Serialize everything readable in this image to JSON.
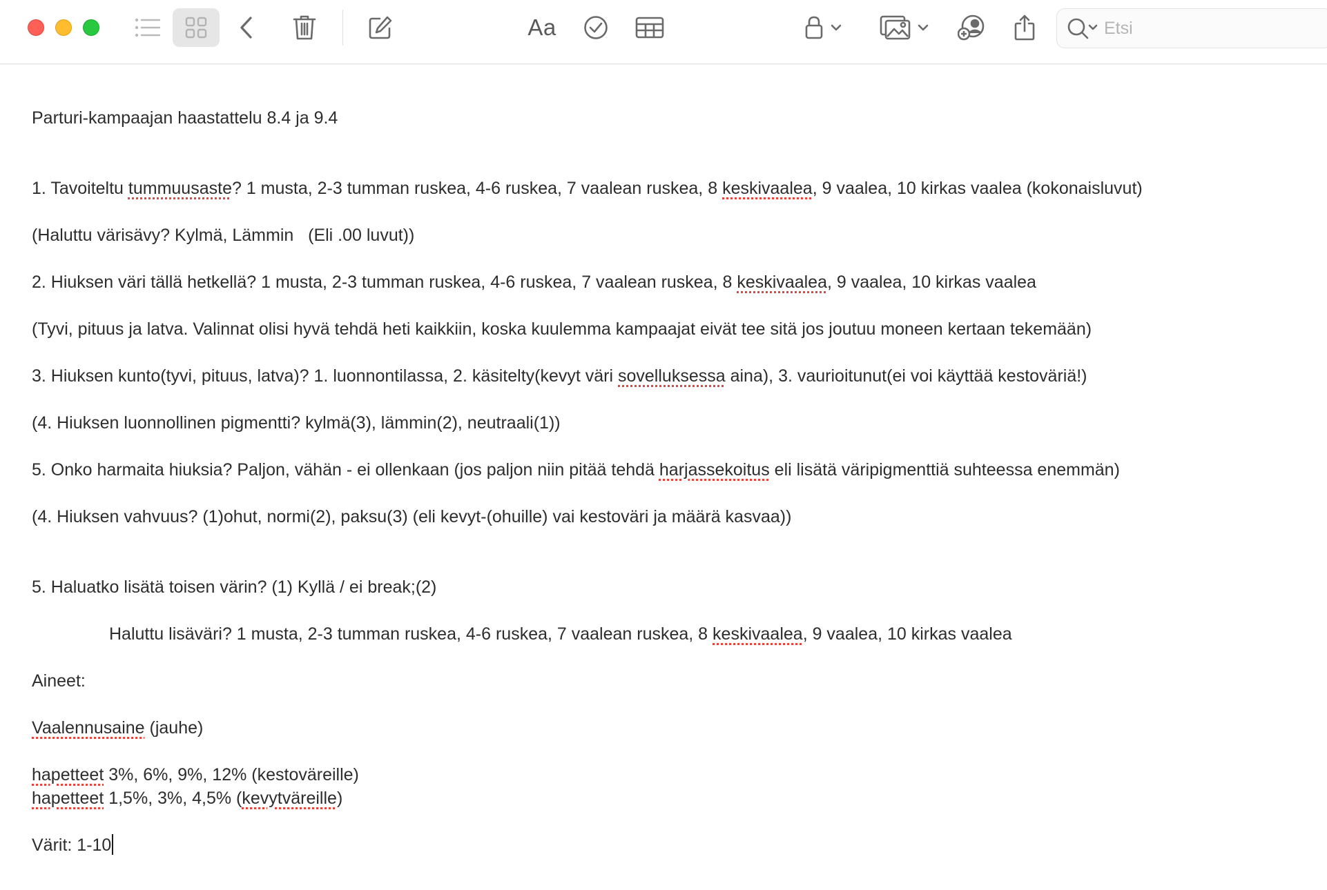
{
  "toolbar": {
    "search_placeholder": "Etsi",
    "format_label": "Aa"
  },
  "note": {
    "title": "Parturi-kampaajan haastattelu 8.4 ja 9.4",
    "q1": {
      "pre": "1. Tavoiteltu ",
      "sp1": "tummuusaste",
      "mid": "? 1 musta, 2-3 tumman ruskea, 4-6 ruskea, 7 vaalean ruskea, 8 ",
      "sp2": "keskivaalea",
      "post": ", 9 vaalea, 10 kirkas vaalea (kokonaisluvut)"
    },
    "q1_note": "(Haluttu värisävy? Kylmä, Lämmin   (Eli .00 luvut))",
    "q2": {
      "pre": "2. Hiuksen väri tällä hetkellä? 1 musta, 2-3 tumman ruskea, 4-6 ruskea, 7 vaalean ruskea, 8 ",
      "sp": "keskivaalea",
      "post": ", 9 vaalea, 10 kirkas vaalea"
    },
    "q2_note": "(Tyvi, pituus ja latva. Valinnat olisi hyvä tehdä heti kaikkiin, koska kuulemma kampaajat eivät tee sitä jos joutuu moneen kertaan tekemään)",
    "q3": {
      "pre": "3. Hiuksen kunto(tyvi, pituus, latva)? 1. luonnontilassa, 2. käsitelty(kevyt väri ",
      "sp": "sovelluksessa",
      "post": " aina), 3. vaurioitunut(ei voi käyttää kestoväriä!)"
    },
    "q4a": "(4. Hiuksen luonnollinen pigmentti? kylmä(3), lämmin(2), neutraali(1))",
    "q5": {
      "pre": "5. Onko harmaita hiuksia? Paljon, vähän - ei ollenkaan (jos paljon niin pitää tehdä ",
      "sp": "harjassekoitus",
      "post": " eli lisätä väripigmenttiä suhteessa enemmän)"
    },
    "q4b": "(4. Hiuksen vahvuus? (1)ohut, normi(2), paksu(3) (eli kevyt-(ohuille) vai kestoväri ja määrä kasvaa))",
    "q6": "5. Haluatko lisätä toisen värin? (1) Kyllä / ei break;(2)",
    "q6_sub": {
      "pre": "Haluttu lisäväri? 1 musta, 2-3 tumman ruskea, 4-6 ruskea, 7 vaalean ruskea, 8 ",
      "sp": "keskivaalea",
      "post": ", 9 vaalea, 10 kirkas vaalea"
    },
    "aineet": "Aineet:",
    "vaal": {
      "sp": "Vaalennusaine",
      "post": " (jauhe)"
    },
    "hap1": {
      "sp": "hapetteet",
      "post": " 3%, 6%, 9%, 12% (kestoväreille)"
    },
    "hap2": {
      "sp": "hapetteet",
      "mid": " 1,5%, 3%, 4,5% (",
      "sp2": "kevytväreille",
      "post": ")"
    },
    "varit": "Värit: 1-10"
  }
}
